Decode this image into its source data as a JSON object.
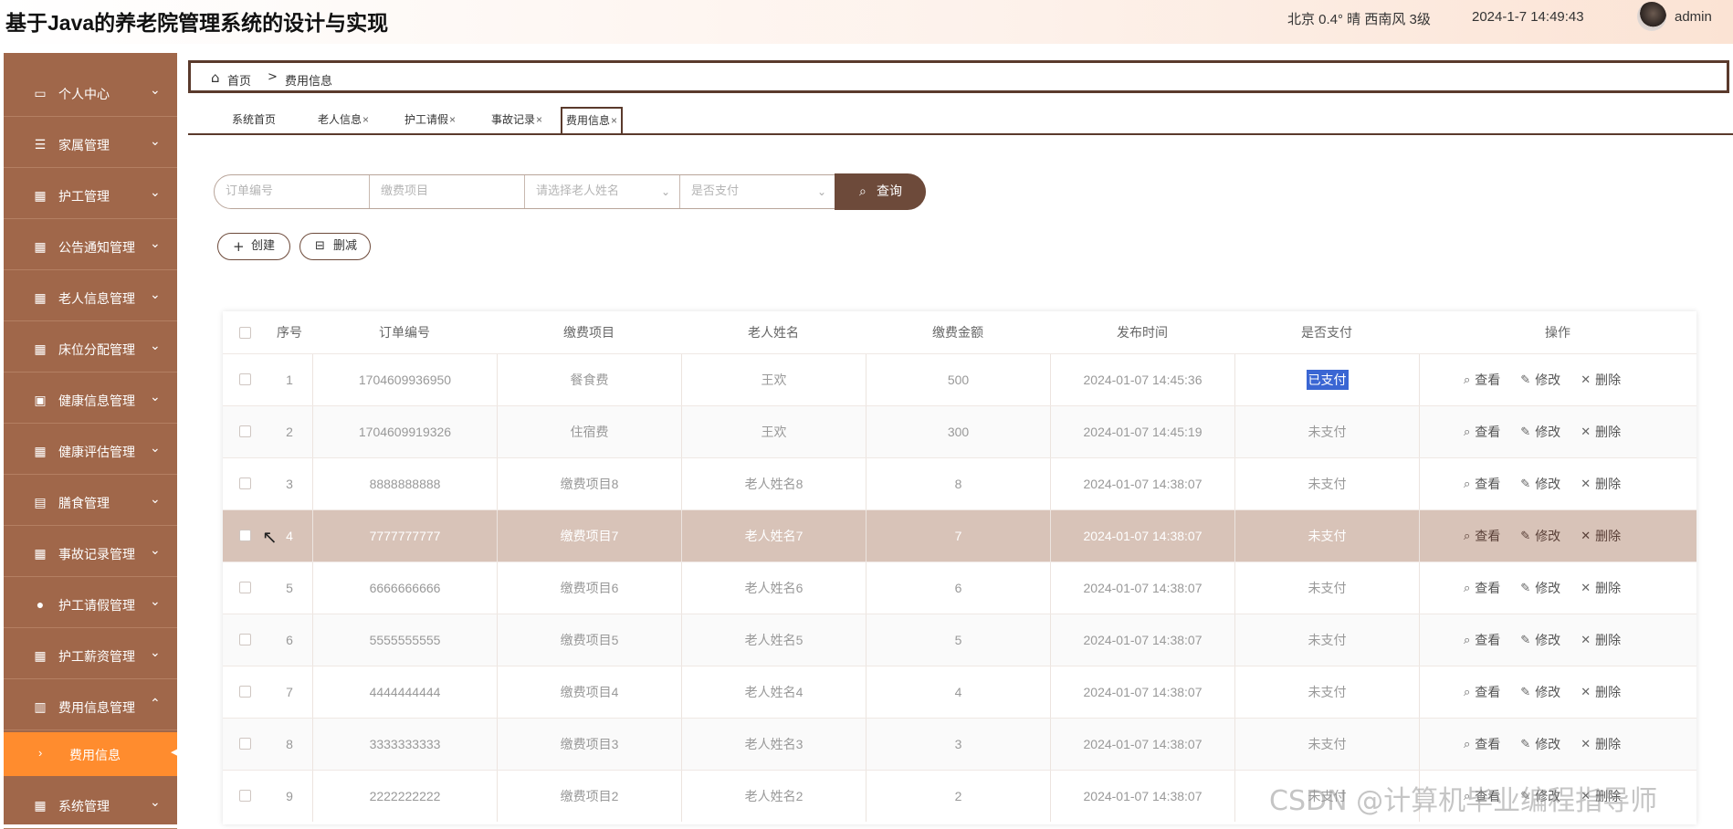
{
  "header": {
    "title": "基于Java的养老院管理系统的设计与实现",
    "weather": "北京  0.4°  晴  西南风  3级",
    "datetime": "2024-1-7 14:49:43",
    "username": "admin"
  },
  "sidebar": {
    "items": [
      {
        "label": "个人中心",
        "icon": "card-icon"
      },
      {
        "label": "家属管理",
        "icon": "list-icon"
      },
      {
        "label": "护工管理",
        "icon": "grid-icon"
      },
      {
        "label": "公告通知管理",
        "icon": "grid-icon"
      },
      {
        "label": "老人信息管理",
        "icon": "grid-icon"
      },
      {
        "label": "床位分配管理",
        "icon": "grid-icon"
      },
      {
        "label": "健康信息管理",
        "icon": "briefcase-icon"
      },
      {
        "label": "健康评估管理",
        "icon": "grid-icon"
      },
      {
        "label": "膳食管理",
        "icon": "clipboard-icon"
      },
      {
        "label": "事故记录管理",
        "icon": "grid-icon"
      },
      {
        "label": "护工请假管理",
        "icon": "user-icon"
      },
      {
        "label": "护工薪资管理",
        "icon": "grid-icon"
      },
      {
        "label": "费用信息管理",
        "icon": "bar-chart-icon"
      },
      {
        "label": "系统管理",
        "icon": "grid-icon"
      }
    ],
    "active_sub": "费用信息"
  },
  "breadcrumb": {
    "home": "首页",
    "sep": ">",
    "current": "费用信息"
  },
  "tabs": [
    {
      "label": "系统首页",
      "closable": false
    },
    {
      "label": "老人信息",
      "closable": true
    },
    {
      "label": "护工请假",
      "closable": true
    },
    {
      "label": "事故记录",
      "closable": true
    },
    {
      "label": "费用信息",
      "closable": true
    }
  ],
  "search": {
    "order_placeholder": "订单编号",
    "item_placeholder": "缴费项目",
    "name_placeholder": "请选择老人姓名",
    "paid_placeholder": "是否支付",
    "button": "查询"
  },
  "actions": {
    "create": "创建",
    "delete": "删减"
  },
  "table": {
    "headers": [
      "序号",
      "订单编号",
      "缴费项目",
      "老人姓名",
      "缴费金额",
      "发布时间",
      "是否支付",
      "操作"
    ],
    "op_view": "查看",
    "op_edit": "修改",
    "op_delete": "删除",
    "rows": [
      {
        "no": "1",
        "order": "1704609936950",
        "item": "餐食费",
        "name": "王欢",
        "amount": "500",
        "time": "2024-01-07 14:45:36",
        "paid": "已支付"
      },
      {
        "no": "2",
        "order": "1704609919326",
        "item": "住宿费",
        "name": "王欢",
        "amount": "300",
        "time": "2024-01-07 14:45:19",
        "paid": "未支付"
      },
      {
        "no": "3",
        "order": "8888888888",
        "item": "缴费项目8",
        "name": "老人姓名8",
        "amount": "8",
        "time": "2024-01-07 14:38:07",
        "paid": "未支付"
      },
      {
        "no": "4",
        "order": "7777777777",
        "item": "缴费项目7",
        "name": "老人姓名7",
        "amount": "7",
        "time": "2024-01-07 14:38:07",
        "paid": "未支付"
      },
      {
        "no": "5",
        "order": "6666666666",
        "item": "缴费项目6",
        "name": "老人姓名6",
        "amount": "6",
        "time": "2024-01-07 14:38:07",
        "paid": "未支付"
      },
      {
        "no": "6",
        "order": "5555555555",
        "item": "缴费项目5",
        "name": "老人姓名5",
        "amount": "5",
        "time": "2024-01-07 14:38:07",
        "paid": "未支付"
      },
      {
        "no": "7",
        "order": "4444444444",
        "item": "缴费项目4",
        "name": "老人姓名4",
        "amount": "4",
        "time": "2024-01-07 14:38:07",
        "paid": "未支付"
      },
      {
        "no": "8",
        "order": "3333333333",
        "item": "缴费项目3",
        "name": "老人姓名3",
        "amount": "3",
        "time": "2024-01-07 14:38:07",
        "paid": "未支付"
      },
      {
        "no": "9",
        "order": "2222222222",
        "item": "缴费项目2",
        "name": "老人姓名2",
        "amount": "2",
        "time": "2024-01-07 14:38:07",
        "paid": "未支付"
      }
    ]
  },
  "watermark": "CSDN @计算机毕业编程指导师",
  "colors": {
    "sidebar": "#a0674a",
    "active": "#ff8c2e",
    "accent": "#6d4a3a",
    "hover_row": "#d8c3b8",
    "highlight": "#3a66d3"
  }
}
